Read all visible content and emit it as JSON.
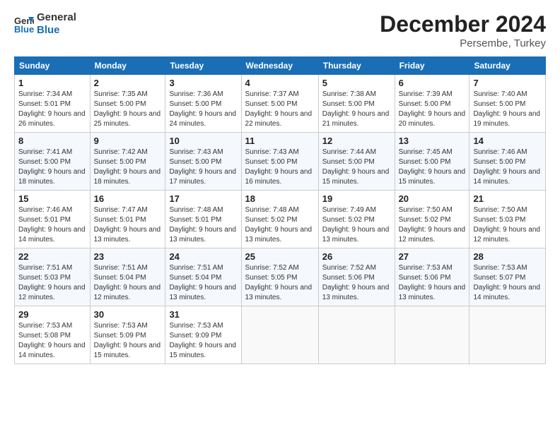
{
  "logo": {
    "line1": "General",
    "line2": "Blue"
  },
  "header": {
    "month": "December 2024",
    "location": "Persembe, Turkey"
  },
  "weekdays": [
    "Sunday",
    "Monday",
    "Tuesday",
    "Wednesday",
    "Thursday",
    "Friday",
    "Saturday"
  ],
  "weeks": [
    [
      {
        "day": "1",
        "sunrise": "7:34 AM",
        "sunset": "5:01 PM",
        "daylight": "9 hours and 26 minutes."
      },
      {
        "day": "2",
        "sunrise": "7:35 AM",
        "sunset": "5:00 PM",
        "daylight": "9 hours and 25 minutes."
      },
      {
        "day": "3",
        "sunrise": "7:36 AM",
        "sunset": "5:00 PM",
        "daylight": "9 hours and 24 minutes."
      },
      {
        "day": "4",
        "sunrise": "7:37 AM",
        "sunset": "5:00 PM",
        "daylight": "9 hours and 22 minutes."
      },
      {
        "day": "5",
        "sunrise": "7:38 AM",
        "sunset": "5:00 PM",
        "daylight": "9 hours and 21 minutes."
      },
      {
        "day": "6",
        "sunrise": "7:39 AM",
        "sunset": "5:00 PM",
        "daylight": "9 hours and 20 minutes."
      },
      {
        "day": "7",
        "sunrise": "7:40 AM",
        "sunset": "5:00 PM",
        "daylight": "9 hours and 19 minutes."
      }
    ],
    [
      {
        "day": "8",
        "sunrise": "7:41 AM",
        "sunset": "5:00 PM",
        "daylight": "9 hours and 18 minutes."
      },
      {
        "day": "9",
        "sunrise": "7:42 AM",
        "sunset": "5:00 PM",
        "daylight": "9 hours and 18 minutes."
      },
      {
        "day": "10",
        "sunrise": "7:43 AM",
        "sunset": "5:00 PM",
        "daylight": "9 hours and 17 minutes."
      },
      {
        "day": "11",
        "sunrise": "7:43 AM",
        "sunset": "5:00 PM",
        "daylight": "9 hours and 16 minutes."
      },
      {
        "day": "12",
        "sunrise": "7:44 AM",
        "sunset": "5:00 PM",
        "daylight": "9 hours and 15 minutes."
      },
      {
        "day": "13",
        "sunrise": "7:45 AM",
        "sunset": "5:00 PM",
        "daylight": "9 hours and 15 minutes."
      },
      {
        "day": "14",
        "sunrise": "7:46 AM",
        "sunset": "5:00 PM",
        "daylight": "9 hours and 14 minutes."
      }
    ],
    [
      {
        "day": "15",
        "sunrise": "7:46 AM",
        "sunset": "5:01 PM",
        "daylight": "9 hours and 14 minutes."
      },
      {
        "day": "16",
        "sunrise": "7:47 AM",
        "sunset": "5:01 PM",
        "daylight": "9 hours and 13 minutes."
      },
      {
        "day": "17",
        "sunrise": "7:48 AM",
        "sunset": "5:01 PM",
        "daylight": "9 hours and 13 minutes."
      },
      {
        "day": "18",
        "sunrise": "7:48 AM",
        "sunset": "5:02 PM",
        "daylight": "9 hours and 13 minutes."
      },
      {
        "day": "19",
        "sunrise": "7:49 AM",
        "sunset": "5:02 PM",
        "daylight": "9 hours and 13 minutes."
      },
      {
        "day": "20",
        "sunrise": "7:50 AM",
        "sunset": "5:02 PM",
        "daylight": "9 hours and 12 minutes."
      },
      {
        "day": "21",
        "sunrise": "7:50 AM",
        "sunset": "5:03 PM",
        "daylight": "9 hours and 12 minutes."
      }
    ],
    [
      {
        "day": "22",
        "sunrise": "7:51 AM",
        "sunset": "5:03 PM",
        "daylight": "9 hours and 12 minutes."
      },
      {
        "day": "23",
        "sunrise": "7:51 AM",
        "sunset": "5:04 PM",
        "daylight": "9 hours and 12 minutes."
      },
      {
        "day": "24",
        "sunrise": "7:51 AM",
        "sunset": "5:04 PM",
        "daylight": "9 hours and 13 minutes."
      },
      {
        "day": "25",
        "sunrise": "7:52 AM",
        "sunset": "5:05 PM",
        "daylight": "9 hours and 13 minutes."
      },
      {
        "day": "26",
        "sunrise": "7:52 AM",
        "sunset": "5:06 PM",
        "daylight": "9 hours and 13 minutes."
      },
      {
        "day": "27",
        "sunrise": "7:53 AM",
        "sunset": "5:06 PM",
        "daylight": "9 hours and 13 minutes."
      },
      {
        "day": "28",
        "sunrise": "7:53 AM",
        "sunset": "5:07 PM",
        "daylight": "9 hours and 14 minutes."
      }
    ],
    [
      {
        "day": "29",
        "sunrise": "7:53 AM",
        "sunset": "5:08 PM",
        "daylight": "9 hours and 14 minutes."
      },
      {
        "day": "30",
        "sunrise": "7:53 AM",
        "sunset": "5:09 PM",
        "daylight": "9 hours and 15 minutes."
      },
      {
        "day": "31",
        "sunrise": "7:53 AM",
        "sunset": "9:09 PM",
        "daylight": "9 hours and 15 minutes."
      },
      null,
      null,
      null,
      null
    ]
  ],
  "labels": {
    "sunrise": "Sunrise:",
    "sunset": "Sunset:",
    "daylight": "Daylight:"
  }
}
